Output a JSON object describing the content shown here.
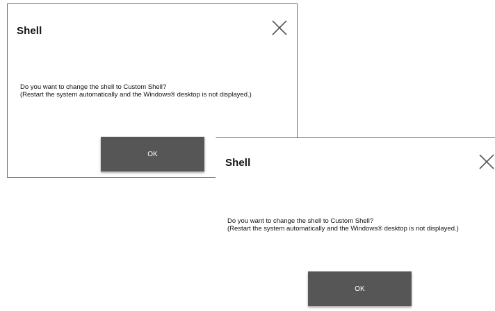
{
  "dialogs": [
    {
      "title": "Shell",
      "message_line1": "Do you want to change the shell to Custom Shell?",
      "message_line2": "(Restart the system automatically and the Windows® desktop is not displayed.)",
      "ok_label": "OK",
      "close_icon": "close-icon"
    },
    {
      "title": "Shell",
      "message_line1": "Do you want to change the shell to Custom Shell?",
      "message_line2": "(Restart the system automatically and the Windows® desktop is not displayed.)",
      "ok_label": "OK",
      "close_icon": "close-icon"
    }
  ],
  "colors": {
    "button_bg": "#565656",
    "button_text": "#ffffff",
    "border": "#6b6b6b"
  }
}
